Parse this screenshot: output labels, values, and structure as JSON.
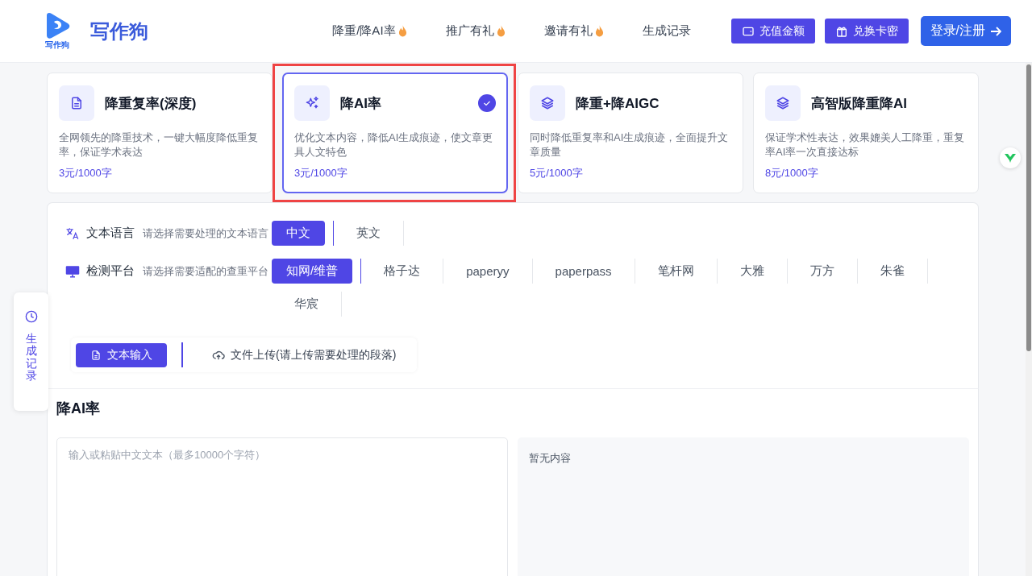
{
  "header": {
    "logo_caption": "写作狗",
    "brand": "写作狗",
    "nav": [
      {
        "label": "降重/降AI率",
        "hot": true
      },
      {
        "label": "推广有礼",
        "hot": true
      },
      {
        "label": "邀请有礼",
        "hot": true
      },
      {
        "label": "生成记录",
        "hot": false
      }
    ],
    "buttons": [
      {
        "label": "充值金额",
        "kind": "wallet"
      },
      {
        "label": "兑换卡密",
        "kind": "gift"
      }
    ],
    "login_button": "登录/注册"
  },
  "services": [
    {
      "title": "降重复率(深度)",
      "description": "全网领先的降重技术，一键大幅度降低重复率，保证学术表达",
      "price": "3元/1000字",
      "kind": "document",
      "selected": false
    },
    {
      "title": "降AI率",
      "description": "优化文本内容，降低AI生成痕迹，使文章更具人文特色",
      "price": "3元/1000字",
      "kind": "sparkle",
      "selected": true
    },
    {
      "title": "降重+降AIGC",
      "description": "同时降低重复率和AI生成痕迹，全面提升文章质量",
      "price": "5元/1000字",
      "kind": "layers",
      "selected": false
    },
    {
      "title": "高智版降重降AI",
      "description": "保证学术性表达，效果媲美人工降重，重复率AI率一次直接达标",
      "price": "8元/1000字",
      "kind": "layers",
      "selected": false
    }
  ],
  "options": {
    "language": {
      "label": "文本语言",
      "hint": "请选择需要处理的文本语言",
      "choices": [
        {
          "label": "中文",
          "selected": true
        },
        {
          "label": "英文",
          "selected": false
        }
      ]
    },
    "platform": {
      "label": "检测平台",
      "hint": "请选择需要适配的查重平台",
      "choices": [
        {
          "label": "知网/维普",
          "selected": true
        },
        {
          "label": "格子达",
          "selected": false
        },
        {
          "label": "paperyy",
          "selected": false
        },
        {
          "label": "paperpass",
          "selected": false
        },
        {
          "label": "笔杆网",
          "selected": false
        },
        {
          "label": "大雅",
          "selected": false
        },
        {
          "label": "万方",
          "selected": false
        },
        {
          "label": "朱雀",
          "selected": false
        },
        {
          "label": "华宸",
          "selected": false
        }
      ]
    },
    "input_modes": [
      {
        "label": "文本输入",
        "kind": "text",
        "selected": true
      },
      {
        "label": "文件上传(请上传需要处理的段落)",
        "kind": "upload",
        "selected": false
      }
    ]
  },
  "editor": {
    "title": "降AI率",
    "input": {
      "placeholder": "输入或粘贴中文文本（最多10000个字符）"
    },
    "output": {
      "empty_text": "暂无内容"
    }
  },
  "side_tab": {
    "label": "生成记录"
  }
}
